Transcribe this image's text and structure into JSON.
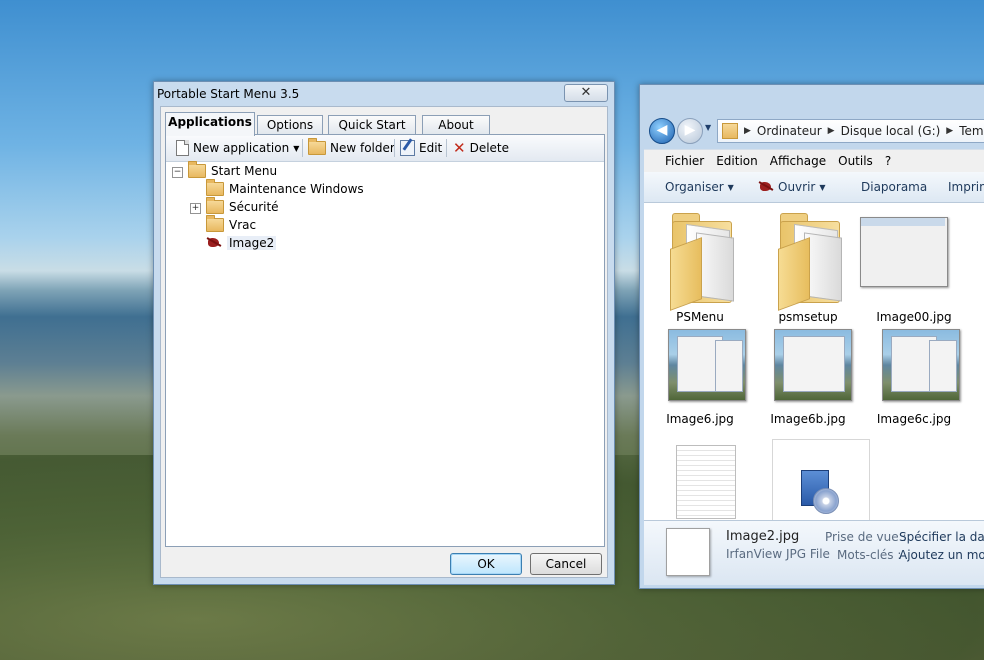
{
  "dialog": {
    "title": "Portable Start Menu 3.5",
    "close_glyph": "✕",
    "tabs": [
      "Applications",
      "Options",
      "Quick Start",
      "About"
    ],
    "toolbar": {
      "new_application": "New application",
      "new_folder": "New folder",
      "edit": "Edit",
      "delete": "Delete"
    },
    "tree": {
      "root": "Start Menu",
      "children": [
        "Maintenance Windows",
        "Sécurité",
        "Vrac",
        "Image2"
      ],
      "expand_glyph": "+",
      "collapse_glyph": "−"
    },
    "ok_label": "OK",
    "cancel_label": "Cancel"
  },
  "explorer": {
    "breadcrumb": [
      "Ordinateur",
      "Disque local (G:)",
      "Temp"
    ],
    "breadcrumb_sep": "▶",
    "back_glyph": "◀",
    "fwd_glyph": "▶",
    "menu": [
      "Fichier",
      "Edition",
      "Affichage",
      "Outils",
      "?"
    ],
    "commands": {
      "organize": "Organiser",
      "open": "Ouvrir",
      "slideshow": "Diaporama",
      "print": "Imprimer"
    },
    "files": [
      "PSMenu",
      "psmsetup",
      "Image00.jpg",
      "Image6.jpg",
      "Image6b.jpg",
      "Image6c.jpg"
    ],
    "details": {
      "name": "Image2.jpg",
      "type": "IrfanView JPG File",
      "date_label": "Prise de vue :",
      "date_value": "Spécifier la date",
      "tags_label": "Mots-clés :",
      "tags_value": "Ajoutez un mot-"
    }
  }
}
